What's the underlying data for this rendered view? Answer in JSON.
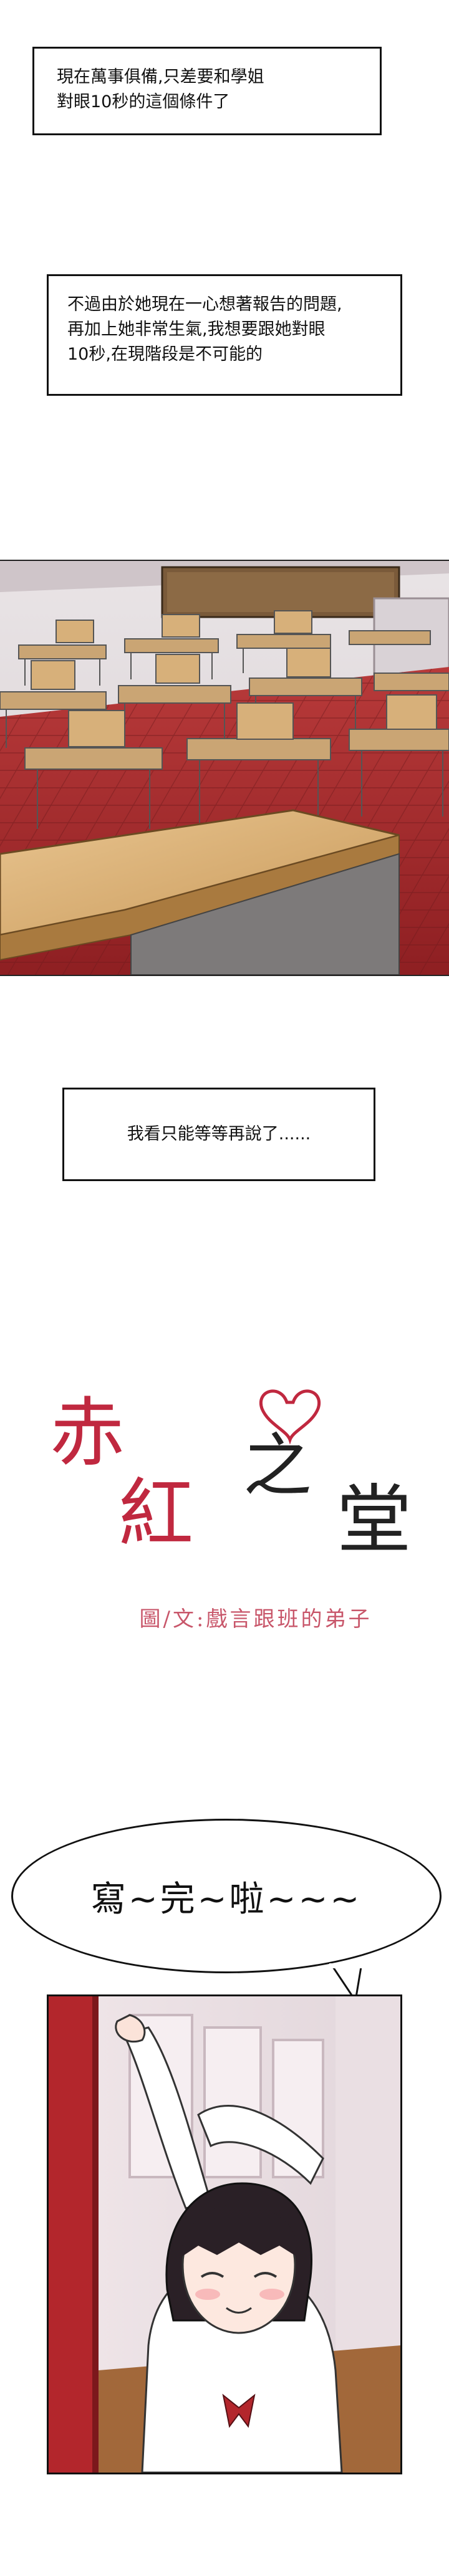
{
  "captions": {
    "first": [
      "現在萬事俱備,只差要和學姐",
      "對眼10秒的這個條件了"
    ],
    "second": [
      "不過由於她現在一心想著報告的問題,",
      "再加上她非常生氣,我想要跟她對眼",
      "10秒,在現階段是不可能的"
    ],
    "third": "我看只能等等再說了......"
  },
  "title": {
    "chars": [
      "赤",
      "紅",
      "之",
      "堂"
    ],
    "credit": "圖/文:戲言跟班的弟子",
    "color": "#c0283f"
  },
  "speech": {
    "text": "寫~完~啦~~~"
  }
}
